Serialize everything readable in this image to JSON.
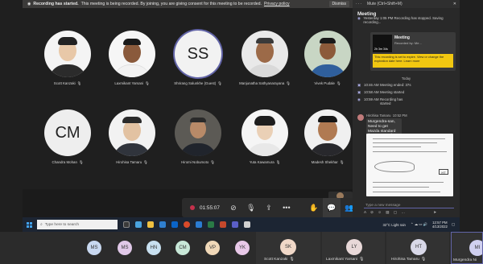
{
  "banner": {
    "title": "Recording has started.",
    "text": "This meeting is being recorded. By joining, you are giving consent for this meeting to be recorded.",
    "policy_link": "Privacy policy",
    "dismiss": "Dismiss"
  },
  "participants": [
    {
      "name": "Scott Kanzaki",
      "initials": ""
    },
    {
      "name": "Laxmikant Yarsani",
      "initials": ""
    },
    {
      "name": "Shrirang Salunkhe (Guest)",
      "initials": "SS"
    },
    {
      "name": "Manjunatha Sathyanarayana",
      "initials": ""
    },
    {
      "name": "Vivek Pudale",
      "initials": ""
    },
    {
      "name": "Chandra Mohan",
      "initials": "CM"
    },
    {
      "name": "Hirohisa Tamaru",
      "initials": ""
    },
    {
      "name": "Hiromi Nobumoto",
      "initials": ""
    },
    {
      "name": "Yuta Kawamura",
      "initials": ""
    },
    {
      "name": "Madesh Shekhar",
      "initials": ""
    }
  ],
  "controls": {
    "timer": "01:55:07"
  },
  "panel": {
    "mute_hint": "Mute (Ctrl+Shift+M)",
    "header": "Meeting",
    "event_yesterday": "Yesterday 1:05 PM   Recording has stopped. Saving recording...",
    "card_title": "Meeting",
    "card_sub": "Recorded by: Me...",
    "card_thumb_time": "2h 3m 34s",
    "card_warning": "This recording is set to expire. View or change the expiration date here. Learn more",
    "today": "Today",
    "event1_time": "10:46 AM",
    "event1_text": "Meeting ended: 37s",
    "event2_time": "10:58 AM",
    "event2_text": "Meeting started",
    "event3_time": "10:59 AM",
    "event3_text": "Recording has started",
    "msg_author": "Hirohisa Tamaru",
    "msg_time": "10:52 PM",
    "msg_text": "Murgendra-san, Need to get Mazda standard (MES BA 209).",
    "doc_label": "HT",
    "compose_placeholder": "Type a new message"
  },
  "taskbar": {
    "search_placeholder": "Type here to search",
    "weather": "32°C  Light rain",
    "time": "12:57 PM",
    "date": "4/13/2022"
  },
  "strip": {
    "initials": [
      "MS",
      "MS",
      "HN",
      "CM",
      "VP",
      "YK"
    ],
    "tiles": [
      {
        "name": "Scott Kanzaki",
        "initials": "SK"
      },
      {
        "name": "Laxmikant Yarsani",
        "initials": "LY"
      },
      {
        "name": "Hirohisa Tamaru",
        "initials": "HT"
      },
      {
        "name": "Murgendra Ni",
        "initials": "MI"
      }
    ]
  },
  "colors": {
    "accent": "#6264a7",
    "leave": "#c4314b",
    "warning": "#f2c811"
  }
}
